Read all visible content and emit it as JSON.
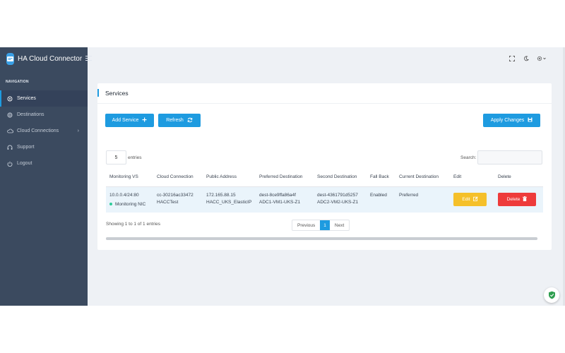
{
  "app": {
    "name": "HA Cloud Connector"
  },
  "sidebar": {
    "heading": "NAVIGATION",
    "items": [
      {
        "label": "Services",
        "icon": "services-icon",
        "active": true
      },
      {
        "label": "Destinations",
        "icon": "destinations-icon"
      },
      {
        "label": "Cloud Connections",
        "icon": "cloud-icon",
        "has_submenu": true
      },
      {
        "label": "Support",
        "icon": "headset-icon"
      },
      {
        "label": "Logout",
        "icon": "power-icon"
      }
    ]
  },
  "topbar": {
    "icons": [
      "fullscreen-icon",
      "dark-mode-icon",
      "settings-icon"
    ]
  },
  "services": {
    "title": "Services",
    "add_label": "Add Service",
    "refresh_label": "Refresh",
    "apply_label": "Apply Changes",
    "length_value": "5",
    "length_suffix": "entries",
    "search_label": "Search:",
    "search_value": "",
    "columns": [
      "Monitoring VS",
      "Cloud Connection",
      "Public Address",
      "Preferred Destination",
      "Second Destination",
      "Fall Back",
      "Current Destination",
      "Edit",
      "Delete"
    ],
    "rows": [
      {
        "monitoring_vs": "10.0.0.4/24:80",
        "monitoring_status": "Monitoring NIC",
        "cloud_connection": "cc-30216ac33472",
        "cloud_connection_name": "HACCTest",
        "public_address": "172.165.88.15",
        "public_address_name": "HACC_UKS_ElasticIP",
        "preferred_destination": "dest-8ce9ffa86a4f",
        "preferred_destination_name": "ADC1-VM1-UKS-Z1",
        "second_destination": "dest-4361791d5257",
        "second_destination_name": "ADC2-VM2-UKS-Z1",
        "fall_back": "Enabled",
        "current_destination": "Preferred",
        "edit_label": "Edit",
        "delete_label": "Delete"
      }
    ],
    "info": "Showing 1 to 1 of 1 entries",
    "pagination": {
      "previous": "Previous",
      "current": "1",
      "next": "Next"
    }
  },
  "colors": {
    "accent": "#1e9be0",
    "sidebar": "#3b4a5f",
    "edit": "#f5c02a",
    "delete": "#ee3b3b",
    "status_ok": "#2ecc9a"
  }
}
